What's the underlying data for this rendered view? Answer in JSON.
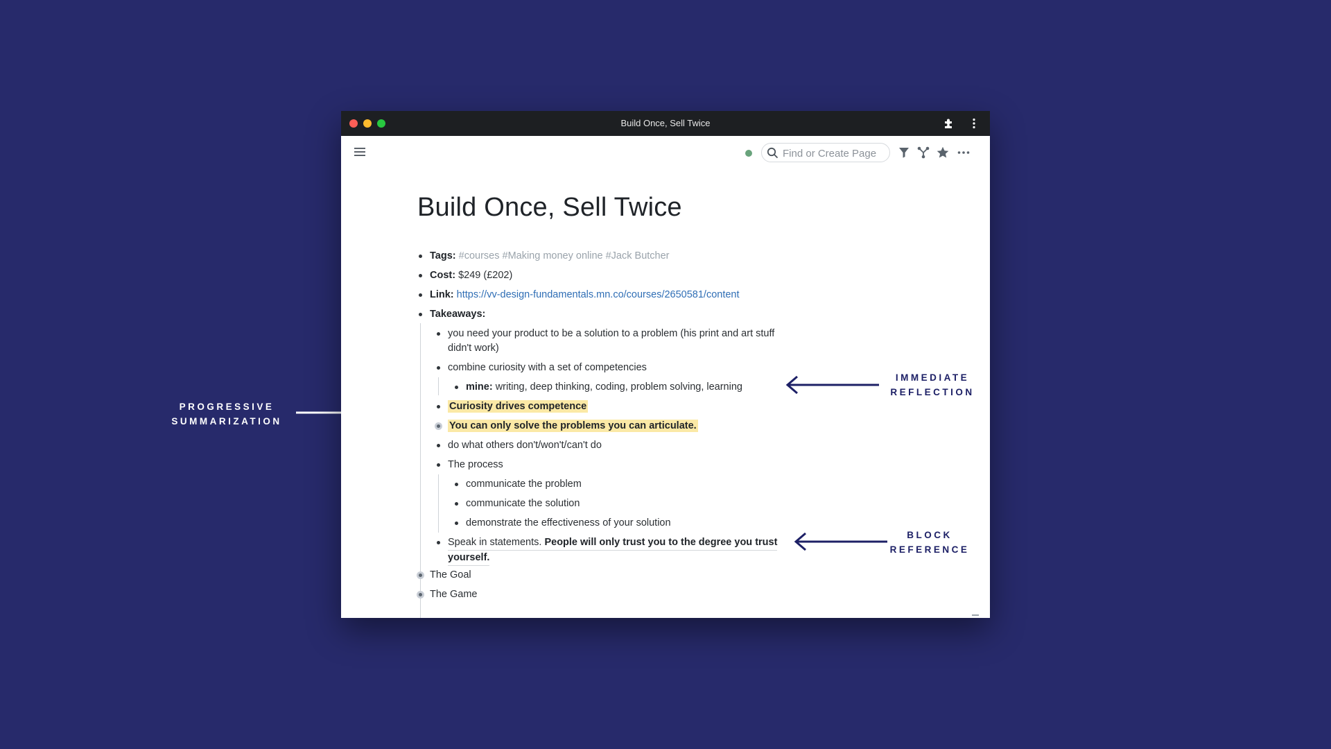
{
  "window": {
    "title": "Build Once, Sell Twice"
  },
  "search": {
    "placeholder": "Find or Create Page"
  },
  "page": {
    "title": "Build Once, Sell Twice",
    "tags_label": "Tags:",
    "tags_value": "#courses #Making money online #Jack Butcher",
    "cost_label": "Cost:",
    "cost_value": "$249 (£202)",
    "link_label": "Link:",
    "link_value": "https://vv-design-fundamentals.mn.co/courses/2650581/content",
    "takeaways_label": "Takeaways:",
    "items": {
      "t1_line1": "you need your product to be a solution to a problem (his print and art stuff",
      "t1_line2": "didn't work)",
      "t2": "combine curiosity with a set of competencies",
      "t2_sub_label": "mine:",
      "t2_sub_value": "writing, deep thinking, coding, problem solving, learning",
      "t3": "Curiosity drives competence",
      "t4": "You can only solve the problems you can articulate.",
      "t5": "do what others don't/won't/can't do",
      "t6": "The process",
      "t6_sub1": "communicate the problem",
      "t6_sub2": "communicate the solution",
      "t6_sub3": "demonstrate the effectiveness of your solution",
      "t7_plain": "Speak in statements.",
      "t7_bold_line1": "People will only trust you to the degree you trust",
      "t7_bold_line2": "yourself."
    },
    "bottom": {
      "goal": "The Goal",
      "game": "The Game"
    }
  },
  "annotations": {
    "progressive_line1": "PROGRESSIVE",
    "progressive_line2": "SUMMARIZATION",
    "immediate_line1": "IMMEDIATE",
    "immediate_line2": "REFLECTION",
    "block_line1": "BLOCK",
    "block_line2": "REFERENCE"
  },
  "colors": {
    "background": "#272a6b",
    "highlight": "#fbe9a6",
    "link": "#2f6eb5",
    "tag": "#9aa3ab",
    "annotation_dark": "#1d2066"
  }
}
